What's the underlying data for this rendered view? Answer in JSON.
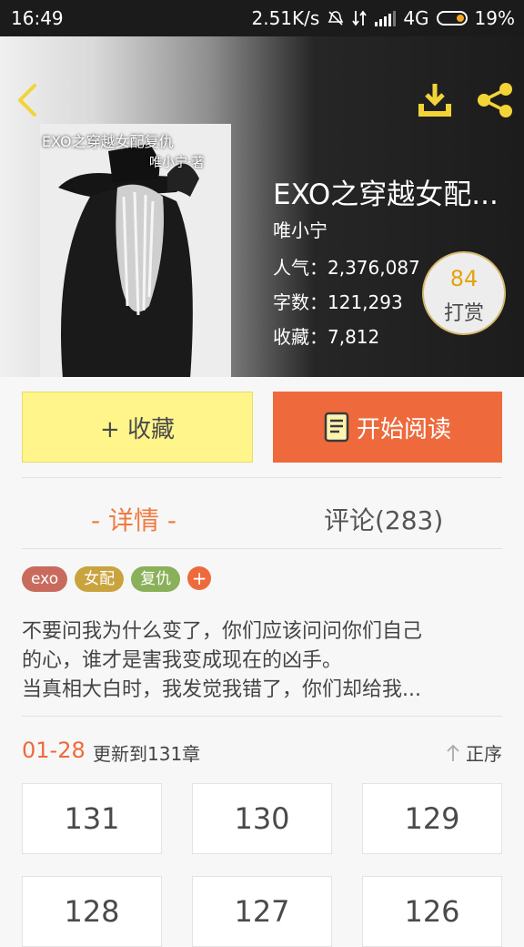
{
  "status_bar": {
    "time": "16:49",
    "net_speed": "2.51K/s",
    "network": "4G",
    "battery": "19%"
  },
  "book": {
    "cover_text": "EXO之穿越女配复仇",
    "cover_author": "唯小宁·著",
    "title": "EXO之穿越女配...",
    "author": "唯小宁",
    "popularity": "人气：2,376,087",
    "word_count": "字数：121,293",
    "favorites": "收藏：7,812",
    "tip_count": "84",
    "tip_label": "打赏"
  },
  "actions": {
    "favorite": "+ 收藏",
    "read": "开始阅读"
  },
  "tabs": {
    "detail": "- 详情 -",
    "comments": "评论(283)"
  },
  "tags": [
    {
      "label": "exo",
      "color": "#c96b5c"
    },
    {
      "label": "女配",
      "color": "#c9a43e"
    },
    {
      "label": "复仇",
      "color": "#8bb05a"
    }
  ],
  "tag_add": "+",
  "description": [
    "不要问我为什么变了，你们应该问问你们自己",
    "的心，谁才是害我变成现在的凶手。",
    "当真相大白时，我发觉我错了，你们却给我..."
  ],
  "update": {
    "date": "01-28",
    "text": "更新到131章",
    "sort": "正序"
  },
  "chapters": [
    "131",
    "130",
    "129",
    "128",
    "127",
    "126"
  ],
  "colors": {
    "accent": "#ee6a3c",
    "fav_button": "#fff58a",
    "icon_yellow": "#f2d437"
  }
}
